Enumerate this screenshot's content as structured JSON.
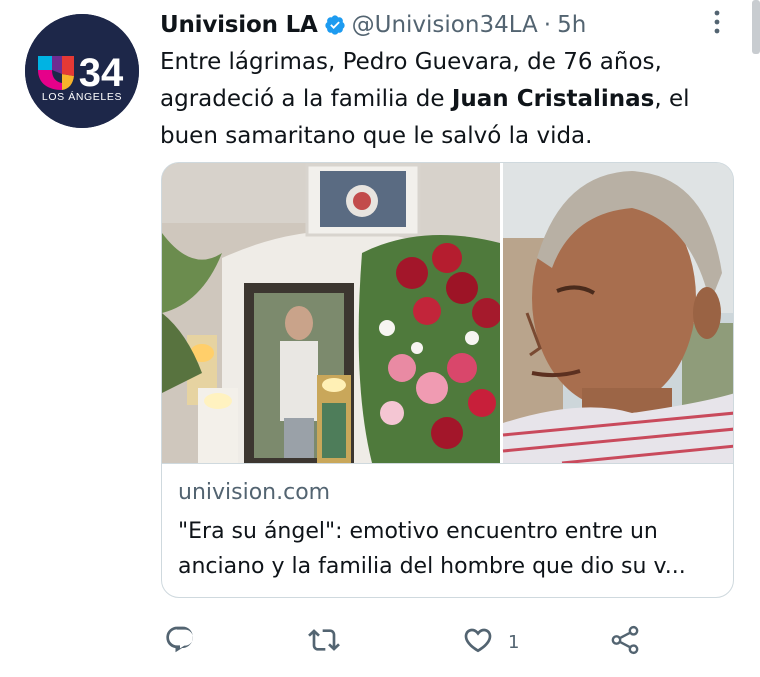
{
  "account": {
    "avatar_number": "34",
    "avatar_city": "LOS ÁNGELES",
    "display_name": "Univision LA",
    "handle": "@Univision34LA",
    "separator": "·",
    "time": "5h",
    "verified": true
  },
  "tweet": {
    "text_before": "Entre lágrimas, Pedro Guevara, de 76 años, agradeció a la familia de ",
    "text_bold": "Juan Cristalinas",
    "text_after": ", el buen samaritano que le salvó la vida."
  },
  "card": {
    "domain": "univision.com",
    "title": "\"Era su ángel\": emotivo encuentro entre un anciano y la familia del hombre que dio su v..."
  },
  "actions": {
    "reply_count": "",
    "retweet_count": "",
    "like_count": "1"
  },
  "colors": {
    "text": "#0f1419",
    "secondary": "#536471",
    "verified": "#1d9bf0",
    "avatar_bg": "#1d2749"
  },
  "icons": {
    "reply": "reply-icon",
    "retweet": "retweet-icon",
    "like": "heart-icon",
    "share": "share-icon",
    "more": "more-options-icon"
  }
}
